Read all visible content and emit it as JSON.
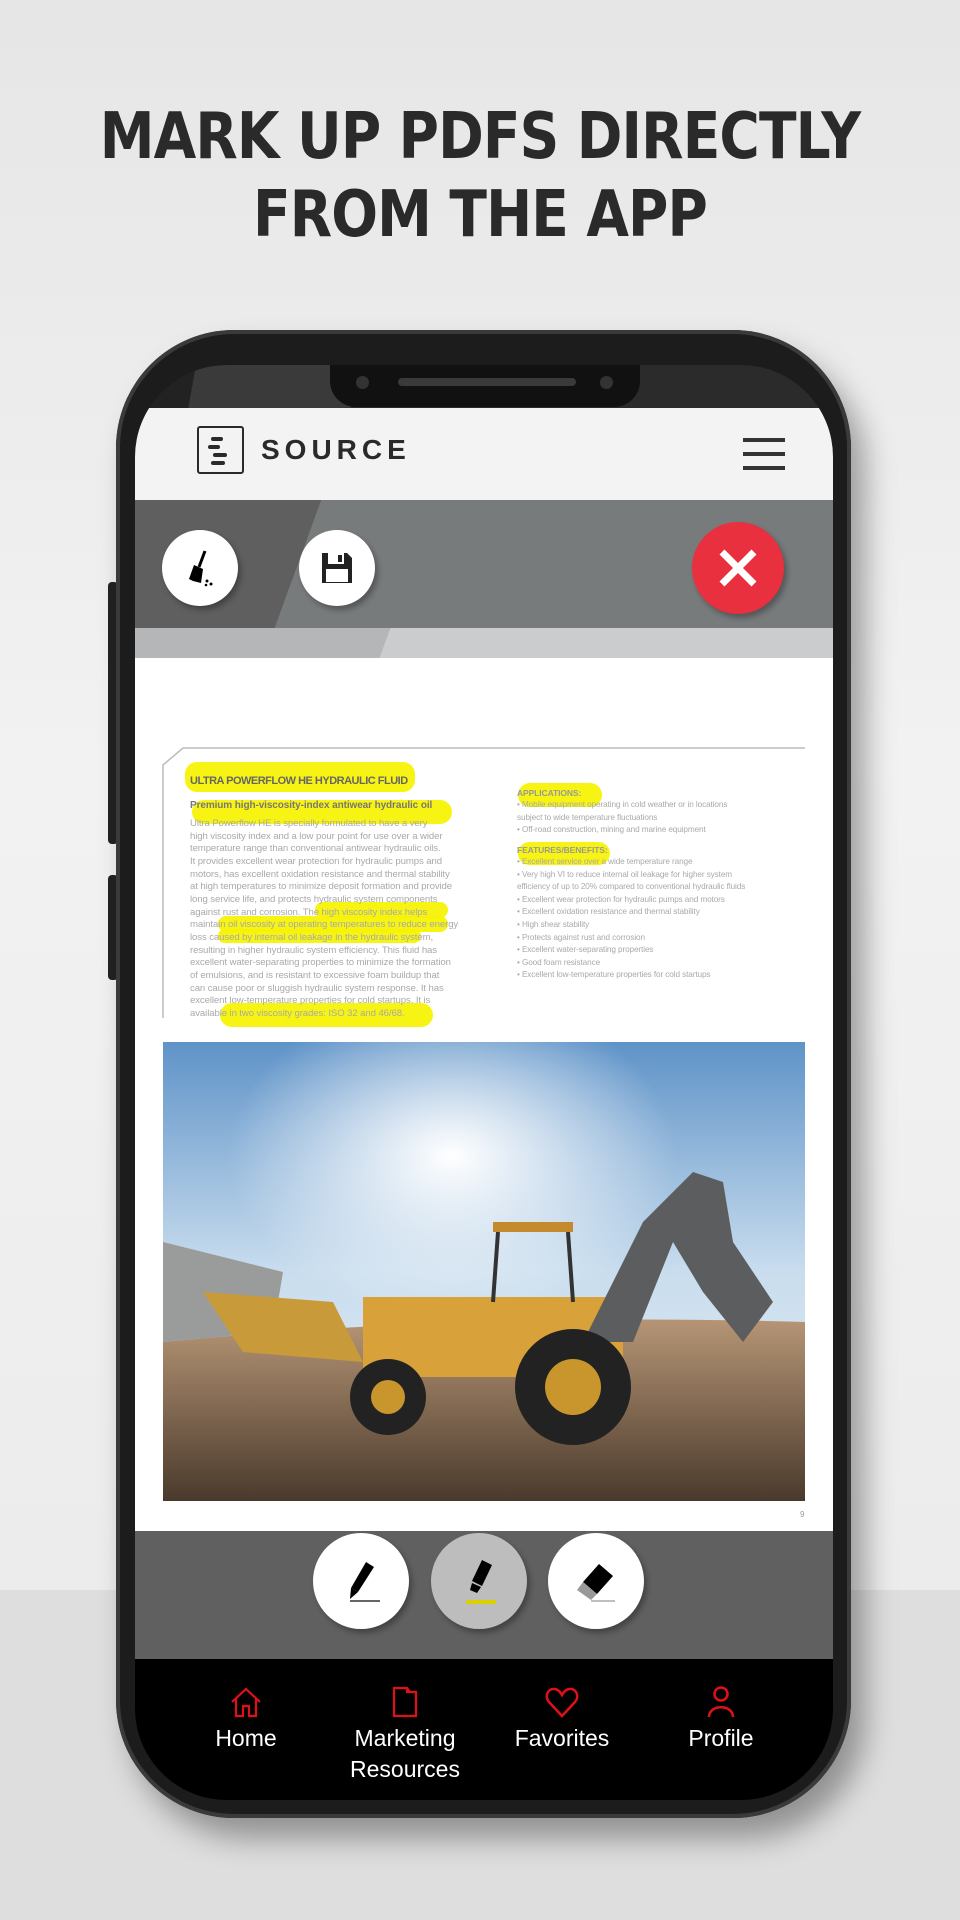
{
  "headline": {
    "line1": "MARK UP PDFS DIRECTLY",
    "line2": "FROM THE APP"
  },
  "header": {
    "logo_text": "SOURCE",
    "menu_icon": "hamburger-icon"
  },
  "toolbar": {
    "clear_icon": "broom-icon",
    "save_icon": "floppy-disk-icon",
    "close_icon": "close-x-icon",
    "close_color": "#e8303f"
  },
  "document": {
    "title": "ULTRA POWERFLOW HE HYDRAULIC FLUID",
    "subtitle": "Premium high-viscosity-index antiwear hydraulic oil",
    "body_lines": [
      "Ultra Powerflow HE is specially formulated to have a very",
      "high viscosity index and a low pour point for use over a wider",
      "temperature range than conventional antiwear hydraulic oils.",
      "It provides excellent wear protection for hydraulic pumps and",
      "motors, has excellent oxidation resistance and thermal stability",
      "at high temperatures to minimize deposit formation and provide",
      "long service life, and protects hydraulic system components",
      "against rust and corrosion. The high viscosity index helps",
      "maintain oil viscosity at operating temperatures to reduce energy",
      "loss caused by internal oil leakage in the hydraulic system,",
      "resulting in higher hydraulic system efficiency. This fluid has",
      "excellent water-separating properties to minimize the formation",
      "of emulsions, and is resistant to excessive foam buildup that",
      "can cause poor or sluggish hydraulic system response. It has",
      "excellent low-temperature properties for cold startups. It is",
      "available in two viscosity grades: ISO 32 and 46/68."
    ],
    "applications_heading": "APPLICATIONS:",
    "applications": [
      "• Mobile equipment operating in cold weather or in locations",
      "   subject to wide temperature fluctuations",
      "• Off-road construction, mining and marine equipment"
    ],
    "features_heading": "FEATURES/BENEFITS:",
    "features": [
      "• Excellent service over a wide temperature range",
      "• Very high VI to reduce internal oil leakage for higher system",
      "   efficiency of up to 20% compared to conventional hydraulic fluids",
      "• Excellent wear protection for hydraulic pumps and motors",
      "• Excellent oxidation resistance and thermal stability",
      "• High shear stability",
      "• Protects against rust and corrosion",
      "• Excellent water-separating properties",
      "• Good foam resistance",
      "• Excellent low-temperature properties for cold startups"
    ],
    "highlight_color": "#f6f300",
    "page_number": "9"
  },
  "markup_tools": [
    {
      "name": "pen",
      "icon": "pen-icon",
      "selected": false
    },
    {
      "name": "highlighter",
      "icon": "highlighter-icon",
      "selected": true
    },
    {
      "name": "eraser",
      "icon": "eraser-icon",
      "selected": false
    }
  ],
  "nav": {
    "accent": "#e0101a",
    "items": [
      {
        "label": "Home",
        "icon": "home-icon"
      },
      {
        "label": "Marketing Resources",
        "icon": "folder-icon"
      },
      {
        "label": "Favorites",
        "icon": "heart-icon"
      },
      {
        "label": "Profile",
        "icon": "person-icon"
      }
    ]
  }
}
